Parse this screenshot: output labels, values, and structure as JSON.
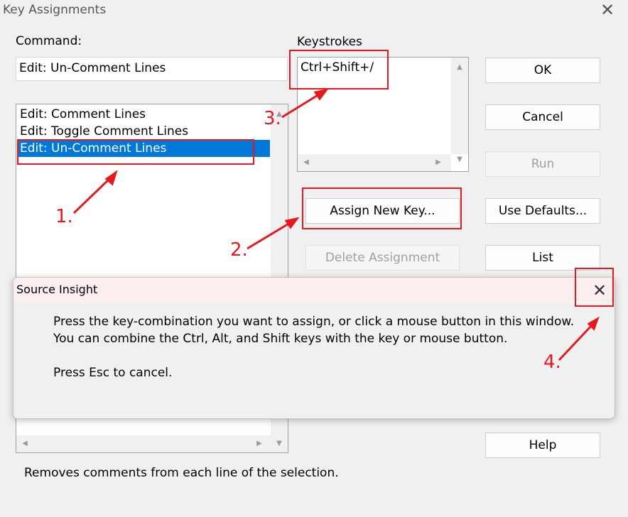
{
  "window": {
    "title": "Key Assignments",
    "close_icon": "close-icon"
  },
  "command": {
    "label": "Command:",
    "value": "Edit: Un-Comment Lines",
    "items": [
      "Edit: Comment Lines",
      "Edit: Toggle Comment Lines",
      "Edit: Un-Comment Lines"
    ],
    "selected_index": 2
  },
  "keystrokes": {
    "label": "Keystrokes",
    "items": [
      "Ctrl+Shift+/"
    ]
  },
  "buttons": {
    "ok": "OK",
    "cancel": "Cancel",
    "run": "Run",
    "use_defaults": "Use Defaults...",
    "list": "List",
    "help": "Help",
    "assign_new_key": "Assign New Key...",
    "delete_assignment": "Delete Assignment"
  },
  "description": "Removes comments from each line of the selection.",
  "popup": {
    "title": "Source Insight",
    "line1": "Press the key-combination you want to assign, or click a mouse button in this window.",
    "line2": "You can combine the Ctrl, Alt, and Shift keys with the key or mouse button.",
    "line3": "Press Esc to cancel."
  },
  "annotations": {
    "n1": "1.",
    "n2": "2.",
    "n3": "3.",
    "n4": "4.",
    "color": "#e8191e"
  },
  "colors": {
    "selection": "#0078d7",
    "popup_title_bg": "#fbeeee"
  }
}
